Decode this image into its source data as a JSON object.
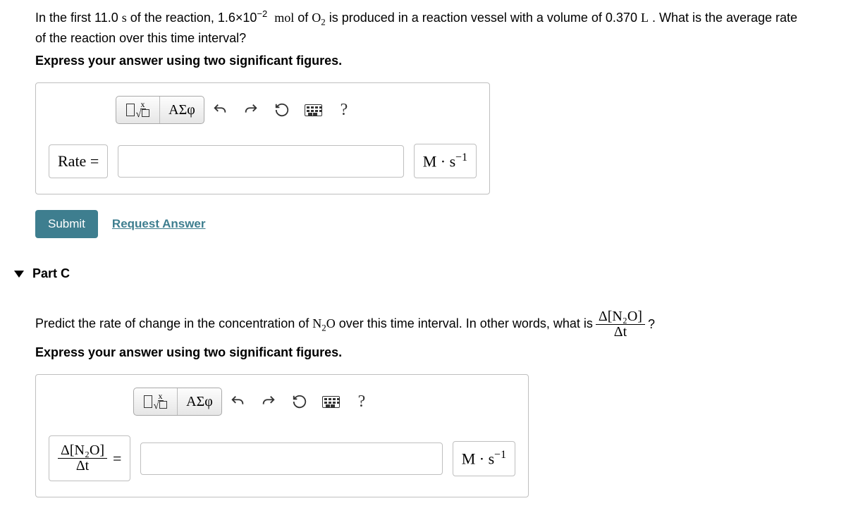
{
  "partB": {
    "text_prefix": "In the first 11.0 ",
    "s_of": " of the reaction, 1.6×10",
    "exp": "−2",
    "mol_of": " of ",
    "o2": "O",
    "o2_sub": "2",
    "produced": " is produced in a reaction vessel with a volume of 0.370 ",
    "volvar": "L",
    "tail": " . What is the average rate of the reaction over this time interval?",
    "svar": "s",
    "molword": "mol",
    "instruction": "Express your answer using two significant figures.",
    "toolbar": {
      "templates": "templates",
      "greek": "ΑΣφ",
      "undo": "↶",
      "redo": "↷",
      "reset": "↻",
      "keyboard": "⌨",
      "help": "?"
    },
    "label_lhs": "Rate =",
    "unit_html": "M · s",
    "unit_exp": "−1",
    "submit": "Submit",
    "request": "Request Answer"
  },
  "partC": {
    "header": "Part C",
    "text_prefix": "Predict the rate of change in the concentration of ",
    "n2o_N": "N",
    "n2o_2": "2",
    "n2o_O": "O",
    "mid": " over this time interval. In other words, what is ",
    "qmark": " ?",
    "frac_num": "Δ[N₂O]",
    "frac_den": "Δt",
    "instruction": "Express your answer using two significant figures.",
    "label_num": "Δ[N₂O]",
    "label_den": "Δt",
    "equals": "=",
    "unit_html": "M · s",
    "unit_exp": "−1"
  }
}
